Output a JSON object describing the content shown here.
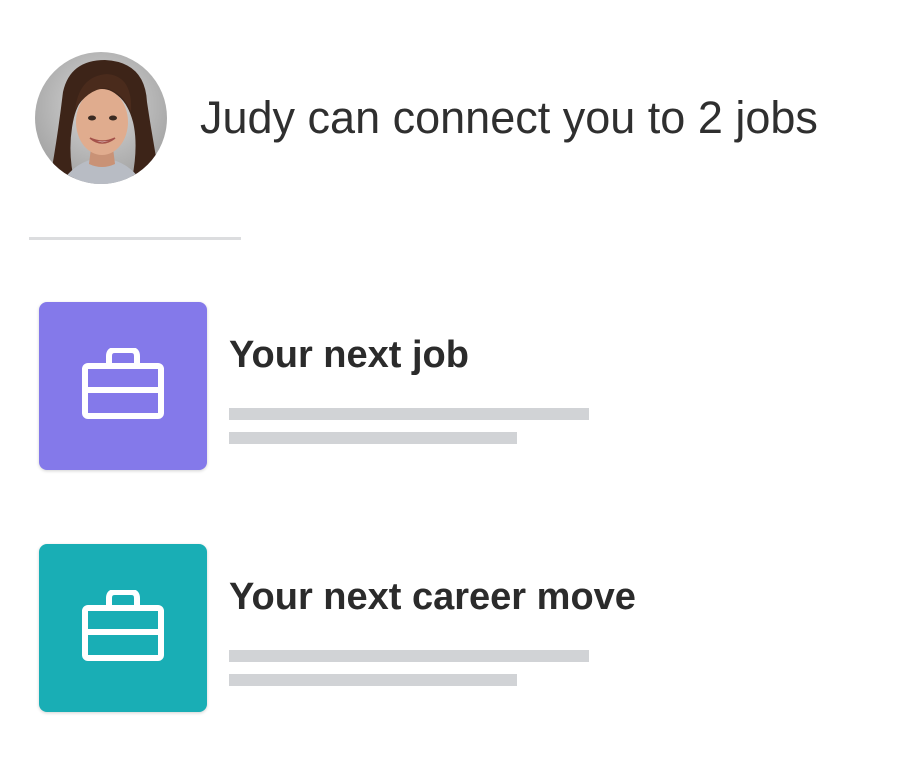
{
  "header": {
    "headline": "Judy can connect you to 2 jobs"
  },
  "jobs": [
    {
      "title": "Your next job",
      "tile_color": "#8479ea",
      "icon": "briefcase-icon"
    },
    {
      "title": "Your next career move",
      "tile_color": "#19aeb5",
      "icon": "briefcase-icon"
    }
  ],
  "colors": {
    "placeholder_bar": "#d1d3d6",
    "divider": "#dcdddf"
  }
}
